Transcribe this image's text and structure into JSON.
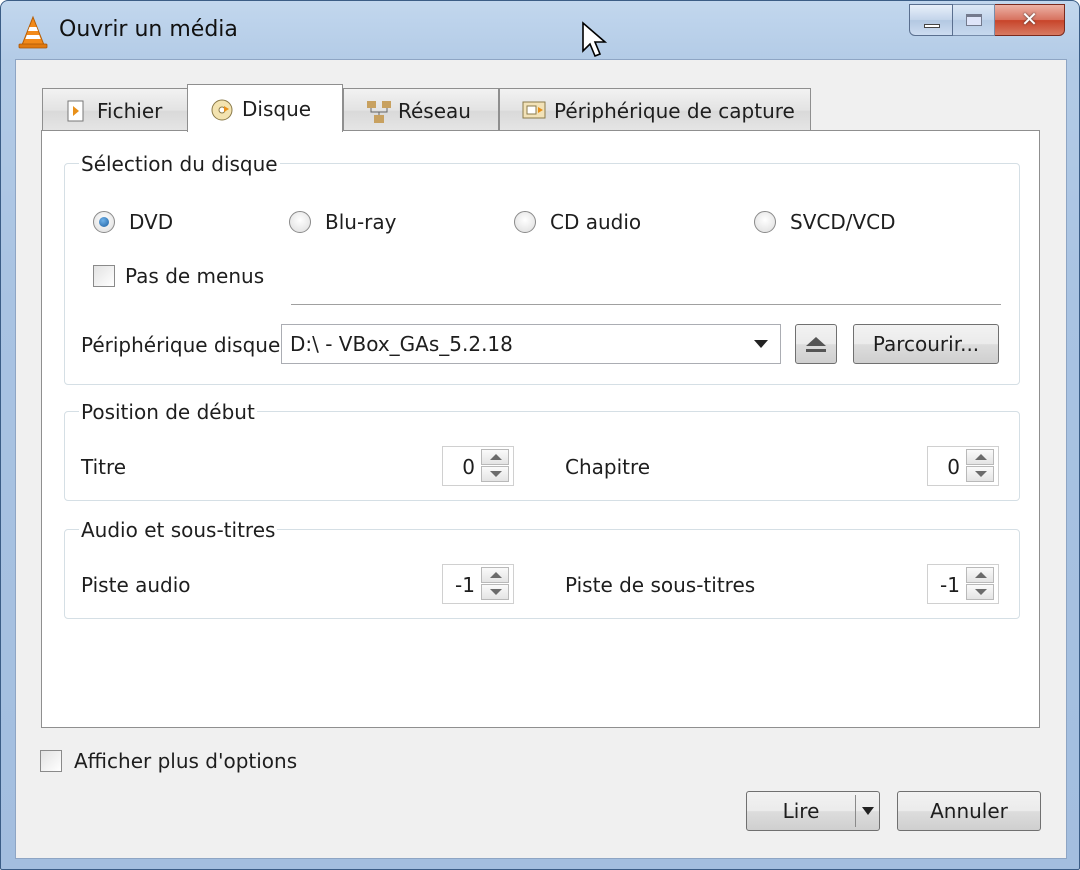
{
  "window": {
    "title": "Ouvrir un média",
    "controls": {
      "minimize": "minimize",
      "maximize": "maximize",
      "close": "✕"
    }
  },
  "tabs": [
    {
      "label": "Fichier",
      "icon": "file-play-icon",
      "active": false
    },
    {
      "label": "Disque",
      "icon": "disc-icon",
      "active": true
    },
    {
      "label": "Réseau",
      "icon": "network-icon",
      "active": false
    },
    {
      "label": "Périphérique de capture",
      "icon": "capture-device-icon",
      "active": false
    }
  ],
  "disc_selection": {
    "title": "Sélection du disque",
    "options": [
      {
        "label": "DVD",
        "checked": true
      },
      {
        "label": "Blu-ray",
        "checked": false
      },
      {
        "label": "CD audio",
        "checked": false
      },
      {
        "label": "SVCD/VCD",
        "checked": false
      }
    ],
    "no_menus_label": "Pas de menus",
    "no_menus_checked": false,
    "device_label": "Périphérique disque",
    "device_value": "D:\\ - VBox_GAs_5.2.18",
    "browse_label": "Parcourir..."
  },
  "start_position": {
    "title": "Position de début",
    "title_label": "Titre",
    "title_value": "0",
    "chapter_label": "Chapitre",
    "chapter_value": "0"
  },
  "audio_subs": {
    "title": "Audio et sous-titres",
    "audio_label": "Piste audio",
    "audio_value": "-1",
    "subs_label": "Piste de sous-titres",
    "subs_value": "-1"
  },
  "more_options_label": "Afficher plus d'options",
  "more_options_checked": false,
  "footer": {
    "play_label": "Lire",
    "cancel_label": "Annuler"
  },
  "colors": {
    "accent": "#1d5fa0",
    "titlebar": "#b3cbe6",
    "close": "#c8442a"
  }
}
